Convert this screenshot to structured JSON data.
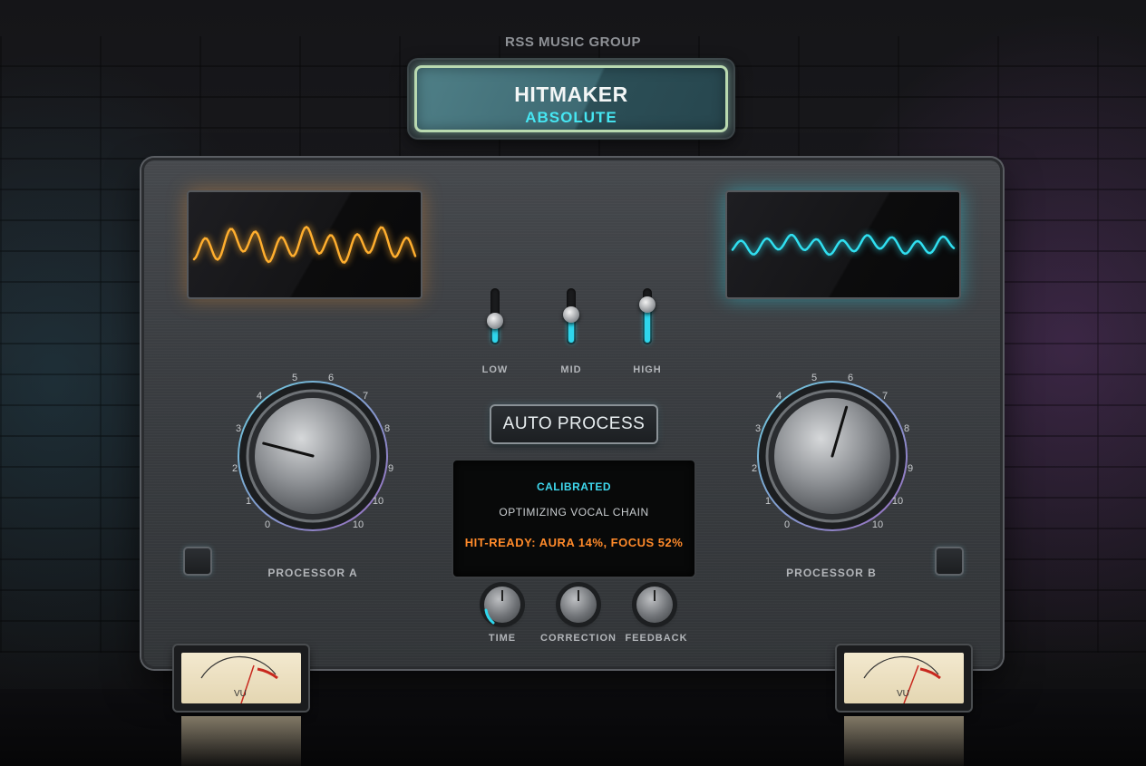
{
  "brand": {
    "company": "RSS MUSIC GROUP",
    "product_name": "HITMAKER",
    "product_edition": "ABSOLUTE"
  },
  "eq_sliders": [
    {
      "label": "LOW",
      "level": 0.35
    },
    {
      "label": "MID",
      "level": 0.5
    },
    {
      "label": "HIGH",
      "level": 0.75
    }
  ],
  "auto_process_label": "AUTO PROCESS",
  "display": {
    "status": "CALIBRATED",
    "message": "OPTIMIZING VOCAL CHAIN",
    "hit_ready": "HIT-READY: AURA 14%, FOCUS 52%"
  },
  "processor_a": {
    "label": "PROCESSOR A",
    "scale": [
      "0",
      "1",
      "2",
      "3",
      "4",
      "5",
      "6",
      "7",
      "8",
      "9",
      "10",
      "10"
    ],
    "value": 2.2
  },
  "processor_b": {
    "label": "PROCESSOR B",
    "scale": [
      "0",
      "1",
      "2",
      "3",
      "4",
      "5",
      "6",
      "7",
      "8",
      "9",
      "10",
      "10"
    ],
    "value": 5.6
  },
  "small_knobs": [
    {
      "label": "TIME"
    },
    {
      "label": "CORRECTION"
    },
    {
      "label": "FEEDBACK"
    }
  ],
  "vu_meter_label": "VU",
  "colors": {
    "wave_a": "#ffae2e",
    "wave_b": "#30dff0",
    "accent_cyan": "#2fd6ec",
    "warning_orange": "#ff8a2a"
  }
}
